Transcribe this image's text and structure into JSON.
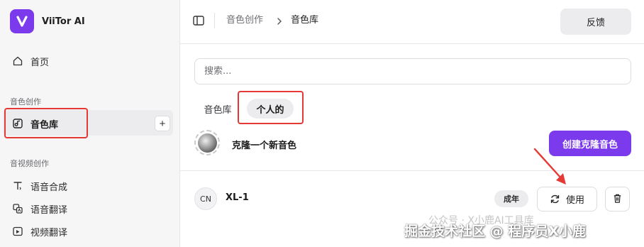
{
  "app": {
    "logo_letter": "V",
    "name": "ViiTor AI",
    "brand_color": "#7c3aed"
  },
  "sidebar": {
    "home_label": "首页",
    "section_voice_creation": "音色创作",
    "voice_library_label": "音色库",
    "add_label": "+",
    "section_av_creation": "音视频创作",
    "items": [
      {
        "label": "语音合成",
        "icon": "speech-synthesis-icon"
      },
      {
        "label": "语音翻译",
        "icon": "speech-translation-icon"
      },
      {
        "label": "视频翻译",
        "icon": "video-translation-icon"
      }
    ]
  },
  "header": {
    "breadcrumb_parent": "音色创作",
    "breadcrumb_current": "音色库",
    "feedback_label": "反馈"
  },
  "main": {
    "search_placeholder": "搜索...",
    "tabs": [
      {
        "label": "音色库",
        "active": false
      },
      {
        "label": "个人的",
        "active": true
      }
    ],
    "clone_label": "克隆一个新音色",
    "create_button_label": "创建克隆音色",
    "voices": [
      {
        "lang": "CN",
        "name": "XL-1",
        "tag": "成年",
        "use_label": "使用"
      }
    ]
  },
  "annotations": {
    "highlight_color": "#e53935"
  },
  "watermark": {
    "line1": "公众号 · X小鹿AI工具库",
    "line2": "掘金技术社区 @ 程序员X小鹿"
  }
}
